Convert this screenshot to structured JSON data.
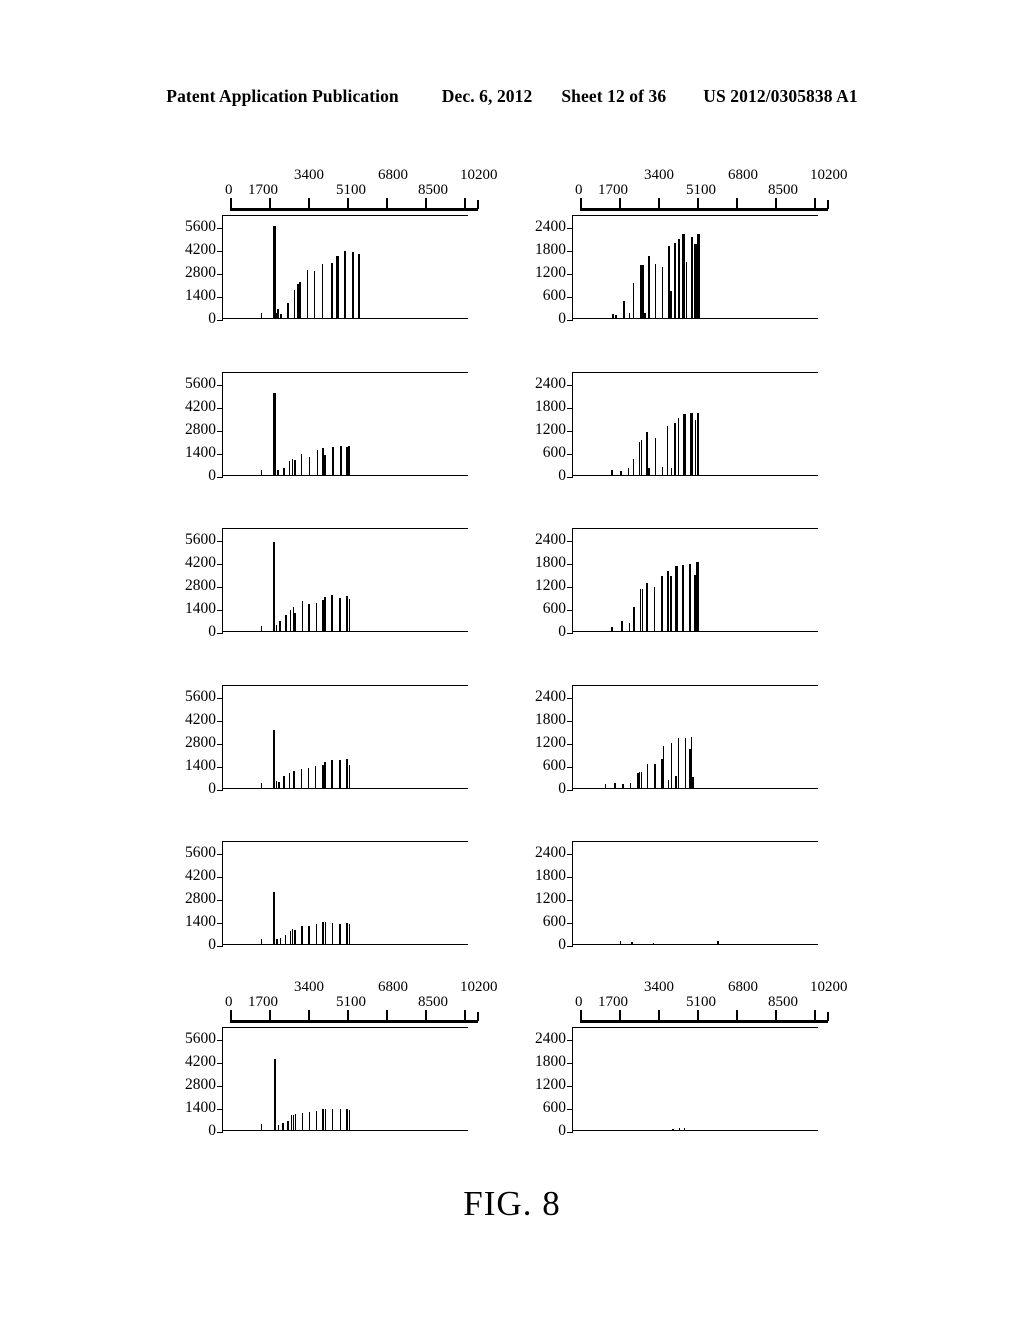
{
  "header": {
    "publication": "Patent Application Publication",
    "date": "Dec. 6, 2012",
    "sheet": "Sheet 12 of 36",
    "patent_number": "US 2012/0305838 A1"
  },
  "caption": "FIG. 8",
  "axis": {
    "x_ticks": [
      "0",
      "1700",
      "3400",
      "5100",
      "6800",
      "8500",
      "10200"
    ],
    "y_ticks_left": [
      "5600",
      "4200",
      "2800",
      "1400",
      "0"
    ],
    "y_ticks_right": [
      "2400",
      "1800",
      "1200",
      "600",
      "0"
    ]
  },
  "chart_data": [
    {
      "id": "panel-L1",
      "type": "bar",
      "title": "",
      "xlabel": "",
      "ylabel": "",
      "xlim": [
        0,
        11900
      ],
      "ylim": [
        0,
        6300
      ],
      "yticks": [
        0,
        1400,
        2800,
        4200,
        5600
      ],
      "xticks": [
        0,
        1700,
        3400,
        5100,
        6800,
        8500,
        10200
      ],
      "grid": false,
      "x": [
        1570,
        2200,
        2300,
        2400,
        2560,
        2900,
        3250,
        3420,
        3520,
        3900,
        4260,
        4660,
        5160,
        5400,
        5800,
        6200,
        6500
      ],
      "values": [
        330,
        5600,
        330,
        560,
        250,
        900,
        1670,
        2050,
        2170,
        2900,
        2850,
        3300,
        3350,
        3750,
        4050,
        3980,
        3880
      ]
    },
    {
      "id": "panel-L2",
      "type": "bar",
      "xlim": [
        0,
        11900
      ],
      "ylim": [
        0,
        6300
      ],
      "yticks": [
        0,
        1400,
        2800,
        4200,
        5600
      ],
      "xticks": [
        0,
        1700,
        3400,
        5100,
        6800,
        8500,
        10200
      ],
      "grid": false,
      "x": [
        1570,
        2200,
        2400,
        2700,
        3000,
        3150,
        3280,
        3600,
        4000,
        4400,
        4700,
        4800,
        5200,
        5600,
        5900,
        6020
      ],
      "values": [
        300,
        4950,
        280,
        400,
        850,
        950,
        900,
        1250,
        1080,
        1500,
        1620,
        1200,
        1700,
        1740,
        1700,
        1750
      ]
    },
    {
      "id": "panel-L3",
      "type": "bar",
      "xlim": [
        0,
        11900
      ],
      "ylim": [
        0,
        6300
      ],
      "yticks": [
        0,
        1400,
        2800,
        4200,
        5600
      ],
      "xticks": [
        0,
        1700,
        3400,
        5100,
        6800,
        8500,
        10200
      ],
      "grid": false,
      "x": [
        1570,
        2180,
        2330,
        2500,
        2800,
        3050,
        3180,
        3280,
        3650,
        3980,
        4350,
        4680,
        4800,
        5160,
        5550,
        5900,
        6030
      ],
      "values": [
        300,
        5420,
        360,
        600,
        950,
        1250,
        1450,
        1100,
        1820,
        1620,
        1690,
        1850,
        2080,
        2180,
        2000,
        2130,
        1930
      ]
    },
    {
      "id": "panel-L4",
      "type": "bar",
      "xlim": [
        0,
        11900
      ],
      "ylim": [
        0,
        6300
      ],
      "yticks": [
        0,
        1400,
        2800,
        4200,
        5600
      ],
      "xticks": [
        0,
        1700,
        3400,
        5100,
        6800,
        8500,
        10200
      ],
      "grid": false,
      "x": [
        1570,
        2190,
        2320,
        2460,
        2700,
        2980,
        3180,
        3240,
        3600,
        3950,
        4320,
        4680,
        4800,
        5150,
        5560,
        5900,
        6030
      ],
      "values": [
        280,
        3520,
        420,
        380,
        700,
        900,
        1030,
        1020,
        1180,
        1200,
        1350,
        1400,
        1550,
        1720,
        1700,
        1760,
        1400
      ]
    },
    {
      "id": "panel-L5",
      "type": "bar",
      "xlim": [
        0,
        11900
      ],
      "ylim": [
        0,
        6300
      ],
      "yticks": [
        0,
        1400,
        2800,
        4200,
        5600
      ],
      "xticks": [
        0,
        1700,
        3400,
        5100,
        6800,
        8500,
        10200
      ],
      "grid": false,
      "x": [
        1570,
        2200,
        2340,
        2520,
        2780,
        3050,
        3150,
        3260,
        3620,
        3980,
        4350,
        4700,
        4820,
        5170,
        5560,
        5900,
        6030
      ],
      "values": [
        280,
        3150,
        280,
        380,
        560,
        800,
        900,
        860,
        1100,
        1080,
        1200,
        1320,
        1330,
        1250,
        1230,
        1270,
        1200
      ]
    },
    {
      "id": "panel-L6",
      "type": "bar",
      "xlim": [
        0,
        11900
      ],
      "ylim": [
        0,
        6300
      ],
      "yticks": [
        0,
        1400,
        2800,
        4200,
        5600
      ],
      "xticks": [
        0,
        1700,
        3400,
        5100,
        6800,
        8500,
        10200
      ],
      "grid": false,
      "x": [
        1570,
        2220,
        2430,
        2650,
        2920,
        3080,
        3180,
        3300,
        3660,
        4000,
        4370,
        4700,
        4830,
        5180,
        5580,
        5910,
        6040
      ],
      "values": [
        350,
        4280,
        320,
        420,
        520,
        880,
        900,
        1000,
        1050,
        1100,
        1140,
        1280,
        1300,
        1270,
        1250,
        1270,
        1230
      ]
    },
    {
      "id": "panel-R1",
      "type": "bar",
      "xlim": [
        0,
        11900
      ],
      "ylim": [
        0,
        2700
      ],
      "yticks": [
        0,
        600,
        1200,
        1800,
        2400
      ],
      "xticks": [
        0,
        1700,
        3400,
        5100,
        6800,
        8500,
        10200
      ],
      "grid": false,
      "x": [
        1640,
        1780,
        2200,
        2480,
        2680,
        3060,
        3160,
        3280,
        3440,
        3800,
        4150,
        4450,
        4600,
        4780,
        4960,
        5200,
        5380,
        5620,
        5820,
        5960
      ],
      "values": [
        110,
        90,
        450,
        120,
        900,
        1380,
        1370,
        130,
        1610,
        1390,
        1320,
        1860,
        700,
        1960,
        2060,
        2190,
        1450,
        2110,
        1930,
        2190
      ]
    },
    {
      "id": "panel-R2",
      "type": "bar",
      "xlim": [
        0,
        11900
      ],
      "ylim": [
        0,
        2700
      ],
      "yticks": [
        0,
        600,
        1200,
        1800,
        2400
      ],
      "xticks": [
        0,
        1700,
        3400,
        5100,
        6800,
        8500,
        10200
      ],
      "grid": false,
      "x": [
        1580,
        2040,
        2440,
        2680,
        3000,
        3100,
        3380,
        3460,
        3800,
        4150,
        4420,
        4620,
        4800,
        4960,
        5260,
        5600,
        5840,
        5940
      ],
      "values": [
        120,
        110,
        180,
        420,
        860,
        900,
        1120,
        170,
        960,
        210,
        1260,
        180,
        1350,
        1470,
        1580,
        1600,
        1440,
        1620
      ]
    },
    {
      "id": "panel-R3",
      "type": "bar",
      "xlim": [
        0,
        11900
      ],
      "ylim": [
        0,
        2700
      ],
      "yticks": [
        0,
        600,
        1200,
        1800,
        2400
      ],
      "xticks": [
        0,
        1700,
        3400,
        5100,
        6800,
        8500,
        10200
      ],
      "grid": false,
      "x": [
        1600,
        2100,
        2480,
        2720,
        3040,
        3140,
        3360,
        3740,
        4120,
        4440,
        4600,
        4840,
        5180,
        5540,
        5800,
        5920
      ],
      "values": [
        100,
        260,
        200,
        620,
        1080,
        1090,
        1240,
        1140,
        1440,
        1550,
        1430,
        1680,
        1710,
        1750,
        1460,
        1800
      ]
    },
    {
      "id": "panel-R4",
      "type": "bar",
      "xlim": [
        0,
        11900
      ],
      "ylim": [
        0,
        2700
      ],
      "yticks": [
        0,
        600,
        1200,
        1800,
        2400
      ],
      "xticks": [
        0,
        1700,
        3400,
        5100,
        6800,
        8500,
        10200
      ],
      "grid": false,
      "x": [
        1260,
        1740,
        2160,
        2520,
        2900,
        3000,
        3080,
        3400,
        3780,
        4120,
        4220,
        4460,
        4620,
        4840,
        4980,
        5320,
        5560,
        5640,
        5700
      ],
      "values": [
        110,
        130,
        110,
        130,
        400,
        410,
        420,
        620,
        620,
        760,
        1080,
        200,
        1180,
        320,
        1300,
        1290,
        1020,
        1320,
        290
      ]
    },
    {
      "id": "panel-R5",
      "type": "bar",
      "xlim": [
        0,
        11900
      ],
      "ylim": [
        0,
        2700
      ],
      "yticks": [
        0,
        600,
        1200,
        1800,
        2400
      ],
      "xticks": [
        0,
        1700,
        3400,
        5100,
        6800,
        8500,
        10200
      ],
      "grid": false,
      "x": [
        2020,
        2600,
        3700,
        6980
      ],
      "values": [
        70,
        45,
        22,
        80
      ]
    },
    {
      "id": "panel-R6",
      "type": "bar",
      "xlim": [
        0,
        11900
      ],
      "ylim": [
        0,
        2700
      ],
      "yticks": [
        0,
        600,
        1200,
        1800,
        2400
      ],
      "xticks": [
        0,
        1700,
        3400,
        5100,
        6800,
        8500,
        10200
      ],
      "grid": false,
      "x": [
        4680,
        5020,
        5280
      ],
      "values": [
        30,
        45,
        55
      ]
    }
  ]
}
